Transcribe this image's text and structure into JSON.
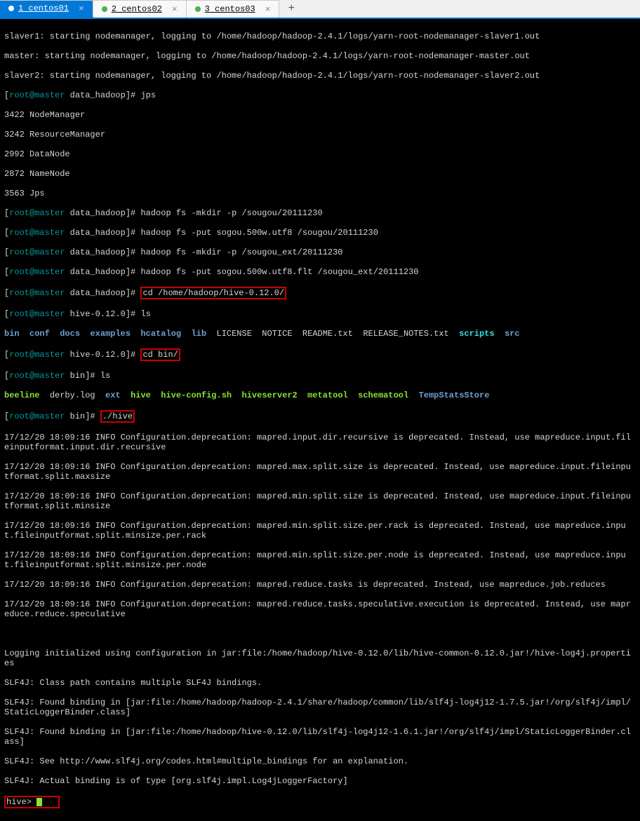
{
  "tabs": {
    "t1": "1 centos01",
    "t2": "2 centos02",
    "t3": "3 centos03",
    "add": "+"
  },
  "term": {
    "l1": "slaver1: starting nodemanager, logging to /home/hadoop/hadoop-2.4.1/logs/yarn-root-nodemanager-slaver1.out",
    "l2": "master: starting nodemanager, logging to /home/hadoop/hadoop-2.4.1/logs/yarn-root-nodemanager-master.out",
    "l3": "slaver2: starting nodemanager, logging to /home/hadoop/hadoop-2.4.1/logs/yarn-root-nodemanager-slaver2.out",
    "p1u": "root@master",
    "p1h": " data_hadoop",
    "p1c": "]# jps",
    "l5": "3422 NodeManager",
    "l6": "3242 ResourceManager",
    "l7": "2992 DataNode",
    "l8": "2872 NameNode",
    "l9": "3563 Jps",
    "p2c": "]# hadoop fs -mkdir -p /sougou/20111230",
    "p3c": "]# hadoop fs -put sogou.500w.utf8 /sougou/20111230",
    "p4c": "]# hadoop fs -mkdir -p /sougou_ext/20111230",
    "p5c": "]# hadoop fs -put sogou.500w.utf8.flt /sougou_ext/20111230",
    "p6a": "]# ",
    "p6b": "cd /home/hadoop/hive-0.12.0/",
    "p7h": " hive-0.12.0",
    "p7c": "]# ls",
    "ls1_bin": "bin",
    "ls1_conf": "conf",
    "ls1_docs": "docs",
    "ls1_examples": "examples",
    "ls1_hcatalog": "hcatalog",
    "ls1_lib": "lib",
    "ls1_r": "LICENSE  NOTICE  README.txt  RELEASE_NOTES.txt",
    "ls1_scripts": "scripts",
    "ls1_src": "src",
    "p8c": "cd bin/",
    "p9h": " bin",
    "p9c": "]# ls",
    "ls2_beeline": "beeline",
    "ls2_derby": "  derby.log  ",
    "ls2_ext": "ext",
    "ls2_sp": "  ",
    "ls2_hive": "hive",
    "ls2_cfg": "hive-config.sh",
    "ls2_hs2": "hiveserver2",
    "ls2_meta": "metatool",
    "ls2_schema": "schematool",
    "ls2_temp": "TempStatsStore",
    "p10c": "./hive",
    "d1": "17/12/20 18:09:16 INFO Configuration.deprecation: mapred.input.dir.recursive is deprecated. Instead, use mapreduce.input.fileinputformat.input.dir.recursive",
    "d2": "17/12/20 18:09:16 INFO Configuration.deprecation: mapred.max.split.size is deprecated. Instead, use mapreduce.input.fileinputformat.split.maxsize",
    "d3": "17/12/20 18:09:16 INFO Configuration.deprecation: mapred.min.split.size is deprecated. Instead, use mapreduce.input.fileinputformat.split.minsize",
    "d4": "17/12/20 18:09:16 INFO Configuration.deprecation: mapred.min.split.size.per.rack is deprecated. Instead, use mapreduce.input.fileinputformat.split.minsize.per.rack",
    "d5": "17/12/20 18:09:16 INFO Configuration.deprecation: mapred.min.split.size.per.node is deprecated. Instead, use mapreduce.input.fileinputformat.split.minsize.per.node",
    "d6": "17/12/20 18:09:16 INFO Configuration.deprecation: mapred.reduce.tasks is deprecated. Instead, use mapreduce.job.reduces",
    "d7": "17/12/20 18:09:16 INFO Configuration.deprecation: mapred.reduce.tasks.speculative.execution is deprecated. Instead, use mapreduce.reduce.speculative",
    "blank": " ",
    "s1": "Logging initialized using configuration in jar:file:/home/hadoop/hive-0.12.0/lib/hive-common-0.12.0.jar!/hive-log4j.properties",
    "s2": "SLF4J: Class path contains multiple SLF4J bindings.",
    "s3": "SLF4J: Found binding in [jar:file:/home/hadoop/hadoop-2.4.1/share/hadoop/common/lib/slf4j-log4j12-1.7.5.jar!/org/slf4j/impl/StaticLoggerBinder.class]",
    "s4": "SLF4J: Found binding in [jar:file:/home/hadoop/hive-0.12.0/lib/slf4j-log4j12-1.6.1.jar!/org/slf4j/impl/StaticLoggerBinder.class]",
    "s5": "SLF4J: See http://www.slf4j.org/codes.html#multiple_bindings for an explanation.",
    "s6": "SLF4J: Actual binding is of type [org.slf4j.impl.Log4jLoggerFactory]",
    "hive": "hive> "
  }
}
